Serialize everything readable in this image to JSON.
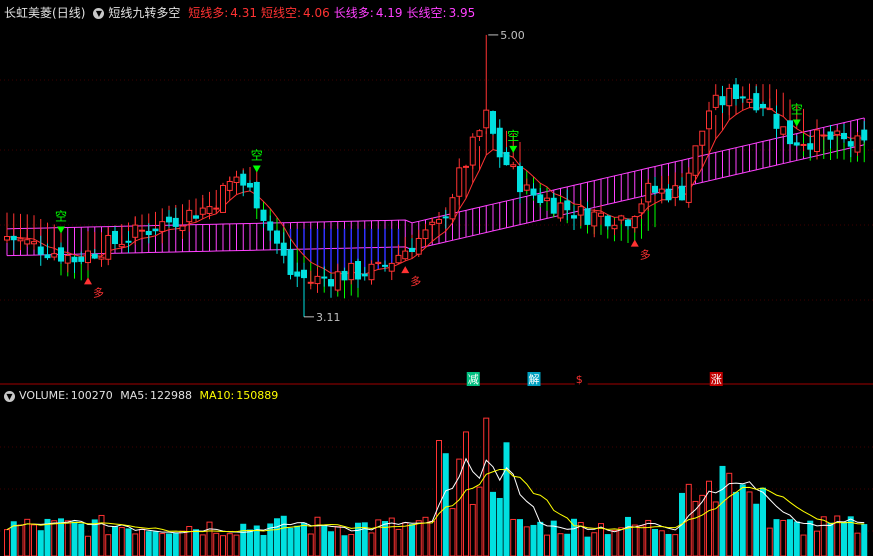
{
  "header": {
    "stock_name": "长虹美菱",
    "period": "(日线)",
    "indicator_name": "短线九转多空",
    "items": [
      {
        "label": "短线多:",
        "value": "4.31",
        "color": "#ff3232"
      },
      {
        "label": "短线空:",
        "value": "4.06",
        "color": "#ff3232"
      },
      {
        "label": "长线多:",
        "value": "4.19",
        "color": "#ff40ff"
      },
      {
        "label": "长线空:",
        "value": "3.95",
        "color": "#ff40ff"
      }
    ]
  },
  "volume_header": {
    "title": "VOLUME:",
    "value": "100270",
    "ma5_label": "MA5:",
    "ma5_value": "122988",
    "ma10_label": "MA10:",
    "ma10_value": "150889"
  },
  "colors": {
    "up": "#ff3232",
    "down": "#00e0e0",
    "ma5": "#ffffff",
    "ma10": "#ffff00",
    "long_band": "#ff40ff",
    "short_bull": "#ff3232",
    "short_bear": "#00ff00",
    "blue_band": "#3030ff"
  },
  "chart_data": {
    "type": "candlestick",
    "price_range": [
      2.7,
      5.1
    ],
    "high_label": "5.00",
    "low_label": "3.11",
    "signal_markers": [
      {
        "text": "空",
        "index": 8,
        "kind": "short"
      },
      {
        "text": "空",
        "index": 37,
        "kind": "short"
      },
      {
        "text": "空",
        "index": 75,
        "kind": "short"
      },
      {
        "text": "空",
        "index": 117,
        "kind": "short"
      },
      {
        "text": "多",
        "index": 12,
        "kind": "long"
      },
      {
        "text": "多",
        "index": 59,
        "kind": "long"
      },
      {
        "text": "多",
        "index": 93,
        "kind": "long"
      }
    ],
    "event_tags": [
      {
        "text": "减",
        "index": 69,
        "bg": "#00c080"
      },
      {
        "text": "解",
        "index": 78,
        "bg": "#00a0c0"
      },
      {
        "text": "$",
        "index": 85,
        "bg": "#000000",
        "fg": "#ff3232"
      },
      {
        "text": "涨",
        "index": 105,
        "bg": "#c00000"
      }
    ]
  }
}
